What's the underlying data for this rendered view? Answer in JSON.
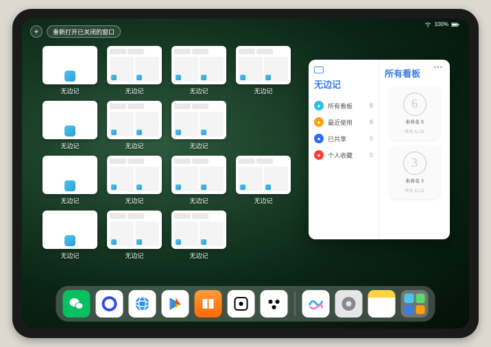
{
  "status": {
    "battery": "100%"
  },
  "topbar": {
    "add": "+",
    "reopen": "重新打开已关闭的窗口"
  },
  "tiles": {
    "label": "无边记"
  },
  "panel": {
    "left": {
      "title": "无边记",
      "items": [
        {
          "label": "所有看板",
          "count": "8",
          "color": "#29c0e8"
        },
        {
          "label": "最近使用",
          "count": "8",
          "color": "#ff9f0a"
        },
        {
          "label": "已共享",
          "count": "0",
          "color": "#2b6ff0"
        },
        {
          "label": "个人收藏",
          "count": "0",
          "color": "#ff3b30"
        }
      ]
    },
    "right": {
      "title": "所有看板",
      "cards": [
        {
          "sketch": "6",
          "label": "未命名 6",
          "time": "昨天 11:25"
        },
        {
          "sketch": "3",
          "label": "未命名 3",
          "time": "昨天 11:23"
        }
      ]
    }
  },
  "dock": {
    "apps": [
      {
        "name": "wechat",
        "bg": "#07c160",
        "glyph": "wechat"
      },
      {
        "name": "quark",
        "bg": "#fff",
        "glyph": "quark"
      },
      {
        "name": "qqbrowser",
        "bg": "#fff",
        "glyph": "qqb"
      },
      {
        "name": "playstore",
        "bg": "#fff",
        "glyph": "play"
      },
      {
        "name": "books",
        "bg": "linear-gradient(#ff9a3d,#ff6a00)",
        "glyph": "books"
      },
      {
        "name": "dice",
        "bg": "#fff",
        "glyph": "dice"
      },
      {
        "name": "atoms",
        "bg": "#fff",
        "glyph": "atoms"
      }
    ],
    "recent": [
      {
        "name": "freeform",
        "bg": "#fff",
        "glyph": "freeform"
      },
      {
        "name": "settings",
        "bg": "#e5e5ea",
        "glyph": "gear"
      },
      {
        "name": "notes",
        "bg": "#fff",
        "glyph": "notes"
      },
      {
        "name": "apps-folder",
        "bg": "rgba(255,255,255,.25)",
        "glyph": "folder"
      }
    ]
  }
}
